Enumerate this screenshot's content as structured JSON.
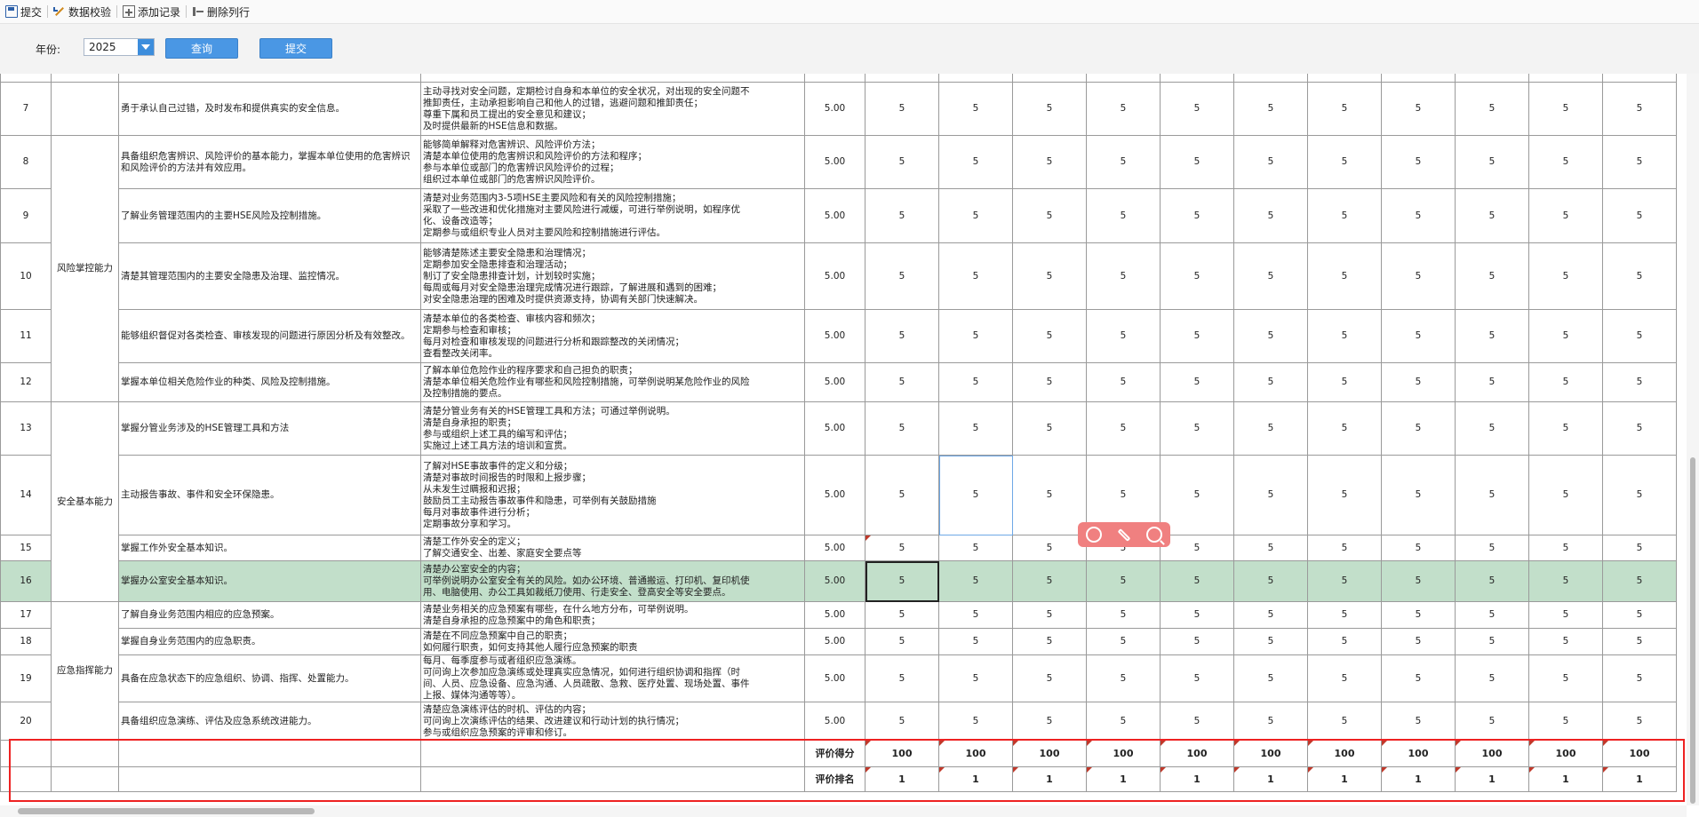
{
  "toolbar": {
    "submit": "提交",
    "validate": "数据校验",
    "add_record": "添加记录",
    "delete_row": "删除列行"
  },
  "filter": {
    "year_label": "年份:",
    "year_value": "2025",
    "query_button": "查询",
    "submit_button": "提交"
  },
  "rows": [
    {
      "no": "7",
      "item": "勇于承认自己过错，及时发布和提供真实的安全信息。",
      "desc": [
        "主动寻找对安全问题，定期检讨自身和本单位的安全状况，对出现的安全问题不",
        "推卸责任，主动承担影响自己和他人的过错，逃避问题和推卸责任；",
        "尊重下属和员工提出的安全意见和建议；",
        "及时提供最新的HSE信息和数据。"
      ],
      "weight": "5.00",
      "scores": [
        "5",
        "5",
        "5",
        "5",
        "5",
        "5",
        "5",
        "5",
        "5",
        "5",
        "5"
      ]
    },
    {
      "no": "8",
      "item": "具备组织危害辨识、风险评价的基本能力，掌握本单位使用的危害辨识和风险评价的方法并有效应用。",
      "desc": [
        "能够简单解释对危害辨识、风险评价方法；",
        "清楚本单位使用的危害辨识和风险评价的方法和程序；",
        "参与本单位或部门的危害辨识风险评价的过程；",
        "组织过本单位或部门的危害辨识风险评价。"
      ],
      "weight": "5.00",
      "scores": [
        "5",
        "5",
        "5",
        "5",
        "5",
        "5",
        "5",
        "5",
        "5",
        "5",
        "5"
      ]
    },
    {
      "no": "9",
      "item": "了解业务管理范围内的主要HSE风险及控制措施。",
      "desc": [
        "清楚对业务范围内3-5项HSE主要风险和有关的风险控制措施；",
        "采取了一些改进和优化措施对主要风险进行减缓，可进行举例说明，如程序优",
        "化、设备改造等；",
        "定期参与或组织专业人员对主要风险和控制措施进行评估。"
      ],
      "weight": "5.00",
      "scores": [
        "5",
        "5",
        "5",
        "5",
        "5",
        "5",
        "5",
        "5",
        "5",
        "5",
        "5"
      ]
    },
    {
      "no": "10",
      "item": "清楚其管理范围内的主要安全隐患及治理、监控情况。",
      "desc": [
        "能够清楚陈述主要安全隐患和治理情况；",
        "定期参加安全隐患排查和治理活动；",
        "制订了安全隐患排查计划，计划较时实施；",
        "每周或每月对安全隐患治理完成情况进行跟踪，了解进展和遇到的困难；",
        "对安全隐患治理的困难及时提供资源支持，协调有关部门快速解决。"
      ],
      "weight": "5.00",
      "scores": [
        "5",
        "5",
        "5",
        "5",
        "5",
        "5",
        "5",
        "5",
        "5",
        "5",
        "5"
      ]
    },
    {
      "no": "11",
      "item": "能够组织督促对各类检查、审核发现的问题进行原因分析及有效整改。",
      "desc": [
        "清楚本单位的各类检查、审核内容和频次；",
        "定期参与检查和审核；",
        "每月对检查和审核发现的问题进行分析和跟踪整改的关闭情况；",
        "查看整改关闭率。"
      ],
      "weight": "5.00",
      "scores": [
        "5",
        "5",
        "5",
        "5",
        "5",
        "5",
        "5",
        "5",
        "5",
        "5",
        "5"
      ]
    },
    {
      "no": "12",
      "item": "掌握本单位相关危险作业的种类、风险及控制措施。",
      "desc": [
        "了解本单位危险作业的程序要求和自己担负的职责；",
        "清楚本单位相关危险作业有哪些和风险控制措施，可举例说明某危险作业的风险",
        "及控制措施的要点。"
      ],
      "weight": "5.00",
      "scores": [
        "5",
        "5",
        "5",
        "5",
        "5",
        "5",
        "5",
        "5",
        "5",
        "5",
        "5"
      ]
    },
    {
      "no": "13",
      "item": "掌握分管业务涉及的HSE管理工具和方法",
      "desc": [
        "清楚分管业务有关的HSE管理工具和方法；可通过举例说明。",
        "清楚自身承担的职责；",
        "参与或组织上述工具的编写和评估；",
        "实施过上述工具方法的培训和宣贯。"
      ],
      "weight": "5.00",
      "scores": [
        "5",
        "5",
        "5",
        "5",
        "5",
        "5",
        "5",
        "5",
        "5",
        "5",
        "5"
      ]
    },
    {
      "no": "14",
      "item": "主动报告事故、事件和安全环保隐患。",
      "desc": [
        "了解对HSE事故事件的定义和分级；",
        "清楚对事故时间报告的时限和上报步骤；",
        "从未发生过瞒报和迟报；",
        "鼓励员工主动报告事故事件和隐患，可举例有关鼓励措施",
        "每月对事故事件进行分析；",
        "定期事故分享和学习。"
      ],
      "weight": "5.00",
      "scores": [
        "5",
        "5",
        "5",
        "5",
        "5",
        "5",
        "5",
        "5",
        "5",
        "5",
        "5"
      ]
    },
    {
      "no": "15",
      "item": "掌握工作外安全基本知识。",
      "desc": [
        "清楚工作外安全的定义；",
        "了解交通安全、出差、家庭安全要点等"
      ],
      "weight": "5.00",
      "scores": [
        "5",
        "5",
        "5",
        "5",
        "5",
        "5",
        "5",
        "5",
        "5",
        "5",
        "5"
      ]
    },
    {
      "no": "16",
      "item": "掌握办公室安全基本知识。",
      "desc": [
        "清楚办公室安全的内容；",
        "可举例说明办公室安全有关的风险。如办公环境、普通搬运、打印机、复印机使",
        "用、电脑使用、办公工具如裁纸刀使用、行走安全、登高安全等安全要点。"
      ],
      "weight": "5.00",
      "scores": [
        "5",
        "5",
        "5",
        "5",
        "5",
        "5",
        "5",
        "5",
        "5",
        "5",
        "5"
      ]
    },
    {
      "no": "17",
      "item": "了解自身业务范围内相应的应急预案。",
      "desc": [
        "清楚业务相关的应急预案有哪些，在什么地方分布，可举例说明。",
        "清楚自身承担的应急预案中的角色和职责；"
      ],
      "weight": "5.00",
      "scores": [
        "5",
        "5",
        "5",
        "5",
        "5",
        "5",
        "5",
        "5",
        "5",
        "5",
        "5"
      ]
    },
    {
      "no": "18",
      "item": "掌握自身业务范围内的应急职责。",
      "desc": [
        "清楚在不同应急预案中自己的职责；",
        "如何履行职责，如何支持其他人履行应急预案的职责"
      ],
      "weight": "5.00",
      "scores": [
        "5",
        "5",
        "5",
        "5",
        "5",
        "5",
        "5",
        "5",
        "5",
        "5",
        "5"
      ]
    },
    {
      "no": "19",
      "item": "具备在应急状态下的应急组织、协调、指挥、处置能力。",
      "desc": [
        "每月、每季度参与或者组织应急演练。",
        "可问询上次参加应急演练或处理真实应急情况，如何进行组织协调和指挥（时",
        "间、人员、应急设备、应急沟通、人员疏散、急救、医疗处置、现场处置、事件",
        "上报、媒体沟通等等）。"
      ],
      "weight": "5.00",
      "scores": [
        "5",
        "5",
        "5",
        "5",
        "5",
        "5",
        "5",
        "5",
        "5",
        "5",
        "5"
      ]
    },
    {
      "no": "20",
      "item": "具备组织应急演练、评估及应急系统改进能力。",
      "desc": [
        "清楚应急演练评估的时机、评估的内容；",
        "可问询上次演练评估的结果、改进建议和行动计划的执行情况；",
        "参与或组织应急预案的评审和修订。"
      ],
      "weight": "5.00",
      "scores": [
        "5",
        "5",
        "5",
        "5",
        "5",
        "5",
        "5",
        "5",
        "5",
        "5",
        "5"
      ]
    }
  ],
  "categories": {
    "risk": "风险掌控能力",
    "safety": "安全基本能力",
    "emergency": "应急指挥能力"
  },
  "summary": {
    "score_label": "评价得分",
    "rank_label": "评价排名",
    "scores": [
      "100",
      "100",
      "100",
      "100",
      "100",
      "100",
      "100",
      "100",
      "100",
      "100",
      "100"
    ],
    "ranks": [
      "1",
      "1",
      "1",
      "1",
      "1",
      "1",
      "1",
      "1",
      "1",
      "1",
      "1"
    ]
  }
}
